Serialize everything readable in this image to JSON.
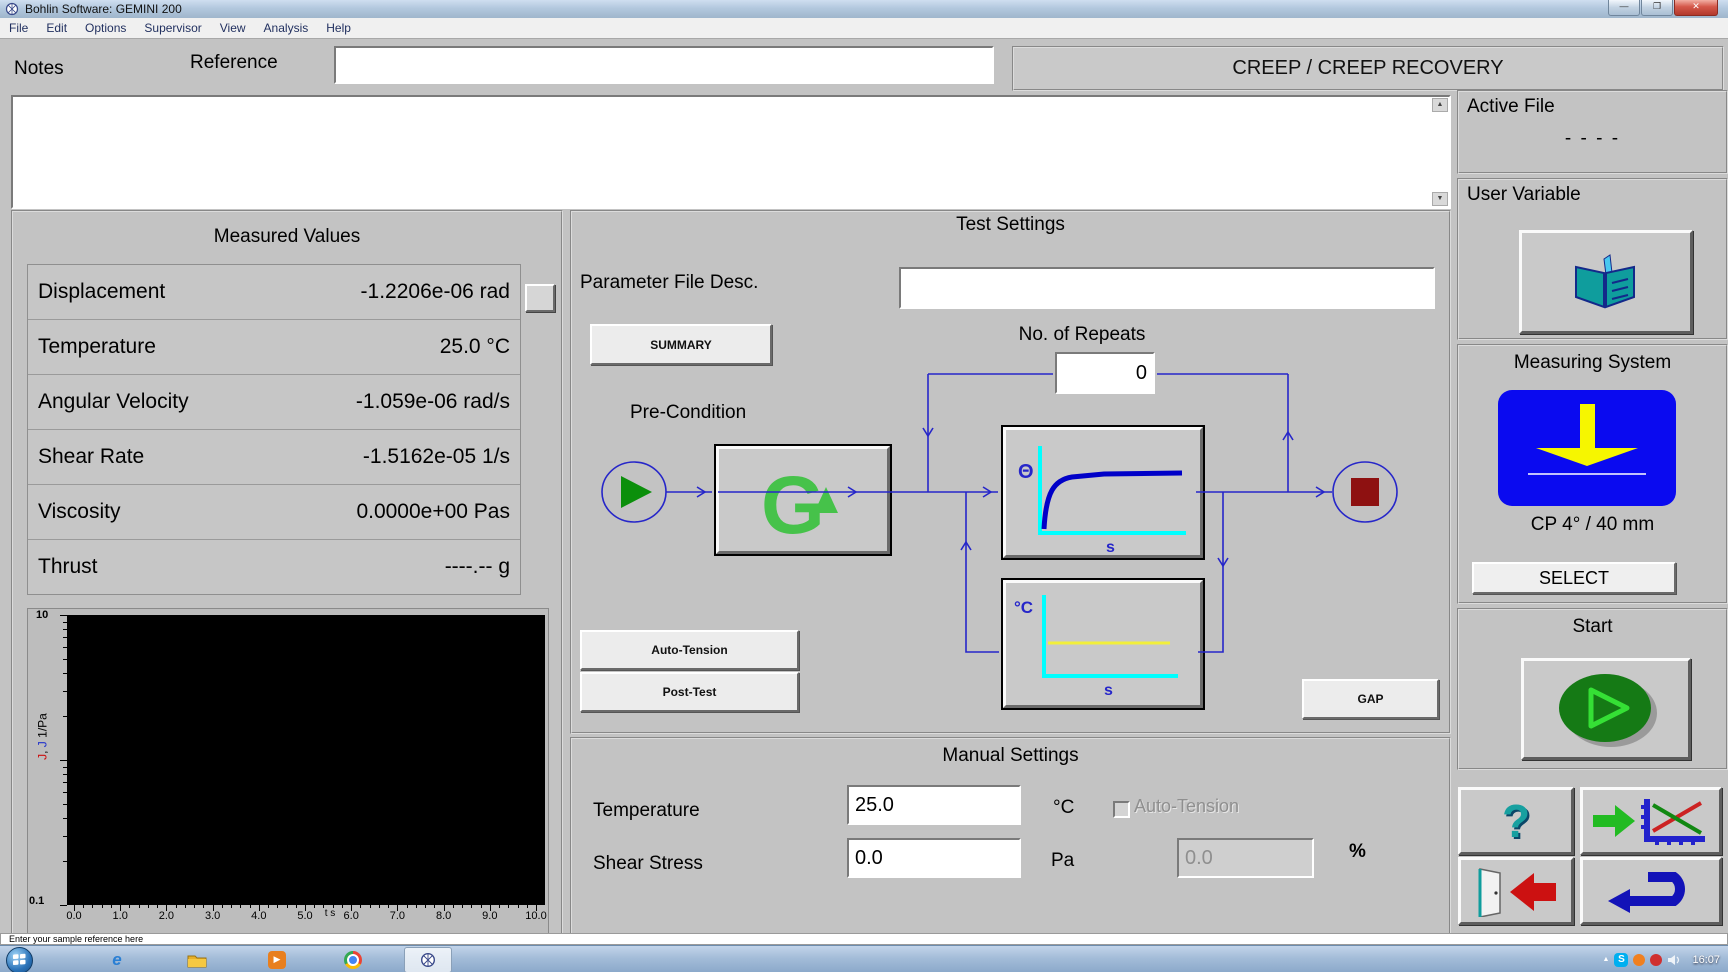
{
  "window": {
    "title": "Bohlin Software: GEMINI 200",
    "controls": {
      "minimize": "—",
      "restore": "❐",
      "close": "✕"
    }
  },
  "menu": {
    "items": [
      "File",
      "Edit",
      "Options",
      "Supervisor",
      "View",
      "Analysis",
      "Help"
    ]
  },
  "header": {
    "notes_label": "Notes",
    "reference_label": "Reference",
    "reference_value": "",
    "notes_value": "",
    "title": "CREEP / CREEP RECOVERY"
  },
  "measured_values": {
    "title": "Measured Values",
    "rows": [
      {
        "label": "Displacement",
        "value": "-1.2206e-06 rad"
      },
      {
        "label": "Temperature",
        "value": "25.0 °C"
      },
      {
        "label": "Angular Velocity",
        "value": "-1.059e-06 rad/s"
      },
      {
        "label": "Shear Rate",
        "value": "-1.5162e-05 1/s"
      },
      {
        "label": "Viscosity",
        "value": "0.0000e+00 Pas"
      },
      {
        "label": "Thrust",
        "value": "----.-- g"
      }
    ]
  },
  "chart_data": {
    "type": "line",
    "title": "",
    "xlabel": "t s",
    "ylabel_series": [
      {
        "symbol": "J",
        "color": "#cc1111"
      },
      {
        "symbol": "J",
        "color": "#2233cc"
      }
    ],
    "ylabel_unit": "1/Pa",
    "x_ticks": [
      "0.0",
      "1.0",
      "2.0",
      "3.0",
      "4.0",
      "5.0",
      "6.0",
      "7.0",
      "8.0",
      "9.0",
      "10.0"
    ],
    "xlim": [
      0,
      10
    ],
    "ylim": [
      0.1,
      10
    ],
    "y_scale": "log",
    "y_max_label": "10",
    "y_min_label": "0.1",
    "grid": false,
    "plot_bg": "#000000",
    "series": []
  },
  "test_settings": {
    "title": "Test Settings",
    "parameter_file_label": "Parameter File Desc.",
    "parameter_file_value": "",
    "summary_button": "SUMMARY",
    "repeats_label": "No. of Repeats",
    "repeats_value": "0",
    "precondition_label": "Pre-Condition",
    "auto_tension_button": "Auto-Tension",
    "post_test_button": "Post-Test",
    "gap_button": "GAP",
    "creep_node": {
      "y_symbol": "Θ",
      "x_symbol": "s"
    },
    "temp_node": {
      "y_symbol": "°C",
      "x_symbol": "s"
    }
  },
  "manual_settings": {
    "title": "Manual Settings",
    "temperature_label": "Temperature",
    "temperature_value": "25.0",
    "temperature_unit": "°C",
    "shear_stress_label": "Shear Stress",
    "shear_stress_value": "0.0",
    "shear_stress_unit": "Pa",
    "auto_tension_label": "Auto-Tension",
    "tension_value": "0.0",
    "tension_unit": "%"
  },
  "sidebar": {
    "active_file": {
      "title": "Active File",
      "value": "- - - -"
    },
    "user_variable": {
      "title": "User Variable"
    },
    "measuring_system": {
      "title": "Measuring System",
      "name": "CP 4° / 40 mm",
      "select_button": "SELECT"
    },
    "start": {
      "title": "Start"
    }
  },
  "status_bar": {
    "text": "Enter your sample reference here"
  },
  "taskbar": {
    "time": "16:07"
  },
  "colors": {
    "flow_line": "#2626c9",
    "plot_bg": "#000000",
    "measuring_icon_bg": "#0a0af0",
    "start_green": "#157a15",
    "stop_red": "#8e1111",
    "axis_cyan": "#00ffff",
    "temp_yellow": "#f2ef3a"
  }
}
